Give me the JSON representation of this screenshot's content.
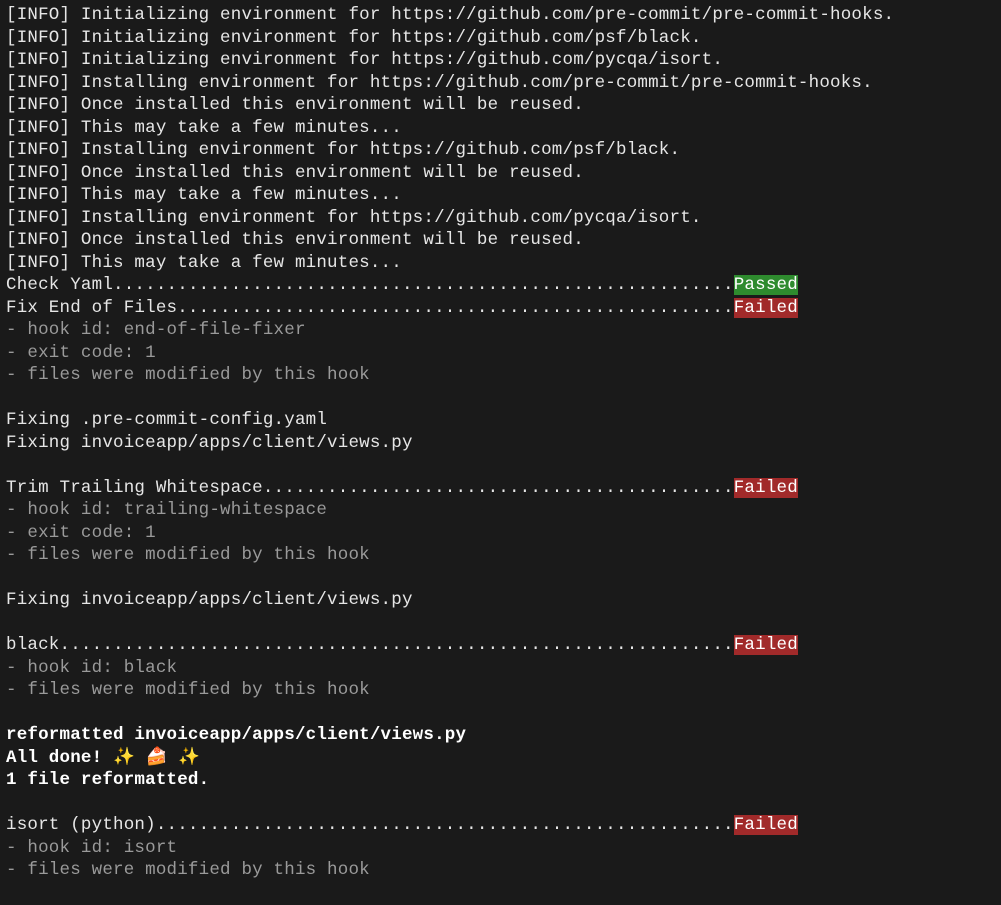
{
  "status_width": 74,
  "status_labels": {
    "passed": "Passed",
    "failed": "Failed"
  },
  "colors": {
    "background": "#1a1a1a",
    "text": "#e6e6e6",
    "dim": "#9a9a9a",
    "bold": "#ffffff",
    "passed_bg": "#2e8b2e",
    "failed_bg": "#a12a2a"
  },
  "lines": [
    {
      "kind": "plain",
      "text": "[INFO] Initializing environment for https://github.com/pre-commit/pre-commit-hooks."
    },
    {
      "kind": "plain",
      "text": "[INFO] Initializing environment for https://github.com/psf/black."
    },
    {
      "kind": "plain",
      "text": "[INFO] Initializing environment for https://github.com/pycqa/isort."
    },
    {
      "kind": "plain",
      "text": "[INFO] Installing environment for https://github.com/pre-commit/pre-commit-hooks."
    },
    {
      "kind": "plain",
      "text": "[INFO] Once installed this environment will be reused."
    },
    {
      "kind": "plain",
      "text": "[INFO] This may take a few minutes..."
    },
    {
      "kind": "plain",
      "text": "[INFO] Installing environment for https://github.com/psf/black."
    },
    {
      "kind": "plain",
      "text": "[INFO] Once installed this environment will be reused."
    },
    {
      "kind": "plain",
      "text": "[INFO] This may take a few minutes..."
    },
    {
      "kind": "plain",
      "text": "[INFO] Installing environment for https://github.com/pycqa/isort."
    },
    {
      "kind": "plain",
      "text": "[INFO] Once installed this environment will be reused."
    },
    {
      "kind": "plain",
      "text": "[INFO] This may take a few minutes..."
    },
    {
      "kind": "status",
      "label": "Check Yaml",
      "status": "passed"
    },
    {
      "kind": "status",
      "label": "Fix End of Files",
      "status": "failed"
    },
    {
      "kind": "dim",
      "text": "- hook id: end-of-file-fixer"
    },
    {
      "kind": "dim",
      "text": "- exit code: 1"
    },
    {
      "kind": "dim",
      "text": "- files were modified by this hook"
    },
    {
      "kind": "blank"
    },
    {
      "kind": "plain",
      "text": "Fixing .pre-commit-config.yaml"
    },
    {
      "kind": "plain",
      "text": "Fixing invoiceapp/apps/client/views.py"
    },
    {
      "kind": "blank"
    },
    {
      "kind": "status",
      "label": "Trim Trailing Whitespace",
      "status": "failed"
    },
    {
      "kind": "dim",
      "text": "- hook id: trailing-whitespace"
    },
    {
      "kind": "dim",
      "text": "- exit code: 1"
    },
    {
      "kind": "dim",
      "text": "- files were modified by this hook"
    },
    {
      "kind": "blank"
    },
    {
      "kind": "plain",
      "text": "Fixing invoiceapp/apps/client/views.py"
    },
    {
      "kind": "blank"
    },
    {
      "kind": "status",
      "label": "black",
      "status": "failed"
    },
    {
      "kind": "dim",
      "text": "- hook id: black"
    },
    {
      "kind": "dim",
      "text": "- files were modified by this hook"
    },
    {
      "kind": "blank"
    },
    {
      "kind": "bold",
      "text": "reformatted invoiceapp/apps/client/views.py"
    },
    {
      "kind": "bold",
      "text": "All done! ✨ 🍰 ✨"
    },
    {
      "kind": "bold",
      "text": "1 file reformatted."
    },
    {
      "kind": "blank"
    },
    {
      "kind": "status",
      "label": "isort (python)",
      "status": "failed"
    },
    {
      "kind": "dim",
      "text": "- hook id: isort"
    },
    {
      "kind": "dim",
      "text": "- files were modified by this hook"
    },
    {
      "kind": "blank"
    }
  ]
}
